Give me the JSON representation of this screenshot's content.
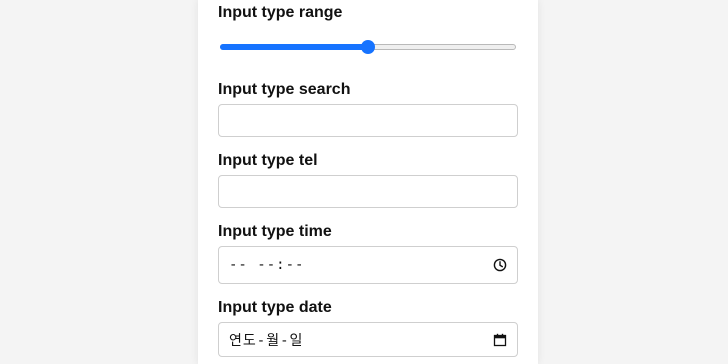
{
  "form": {
    "range": {
      "label": "Input type range",
      "value": 0.5
    },
    "search": {
      "label": "Input type search",
      "value": ""
    },
    "tel": {
      "label": "Input type tel",
      "value": ""
    },
    "time": {
      "label": "Input type time",
      "display": "-- --:--",
      "icon": "clock-icon"
    },
    "date": {
      "label": "Input type date",
      "display": "연도-월-일",
      "icon": "calendar-icon"
    }
  },
  "colors": {
    "accent": "#1673ff",
    "page_background": "#f4f4f4",
    "panel_background": "#ffffff",
    "border": "#cfcfcf"
  }
}
